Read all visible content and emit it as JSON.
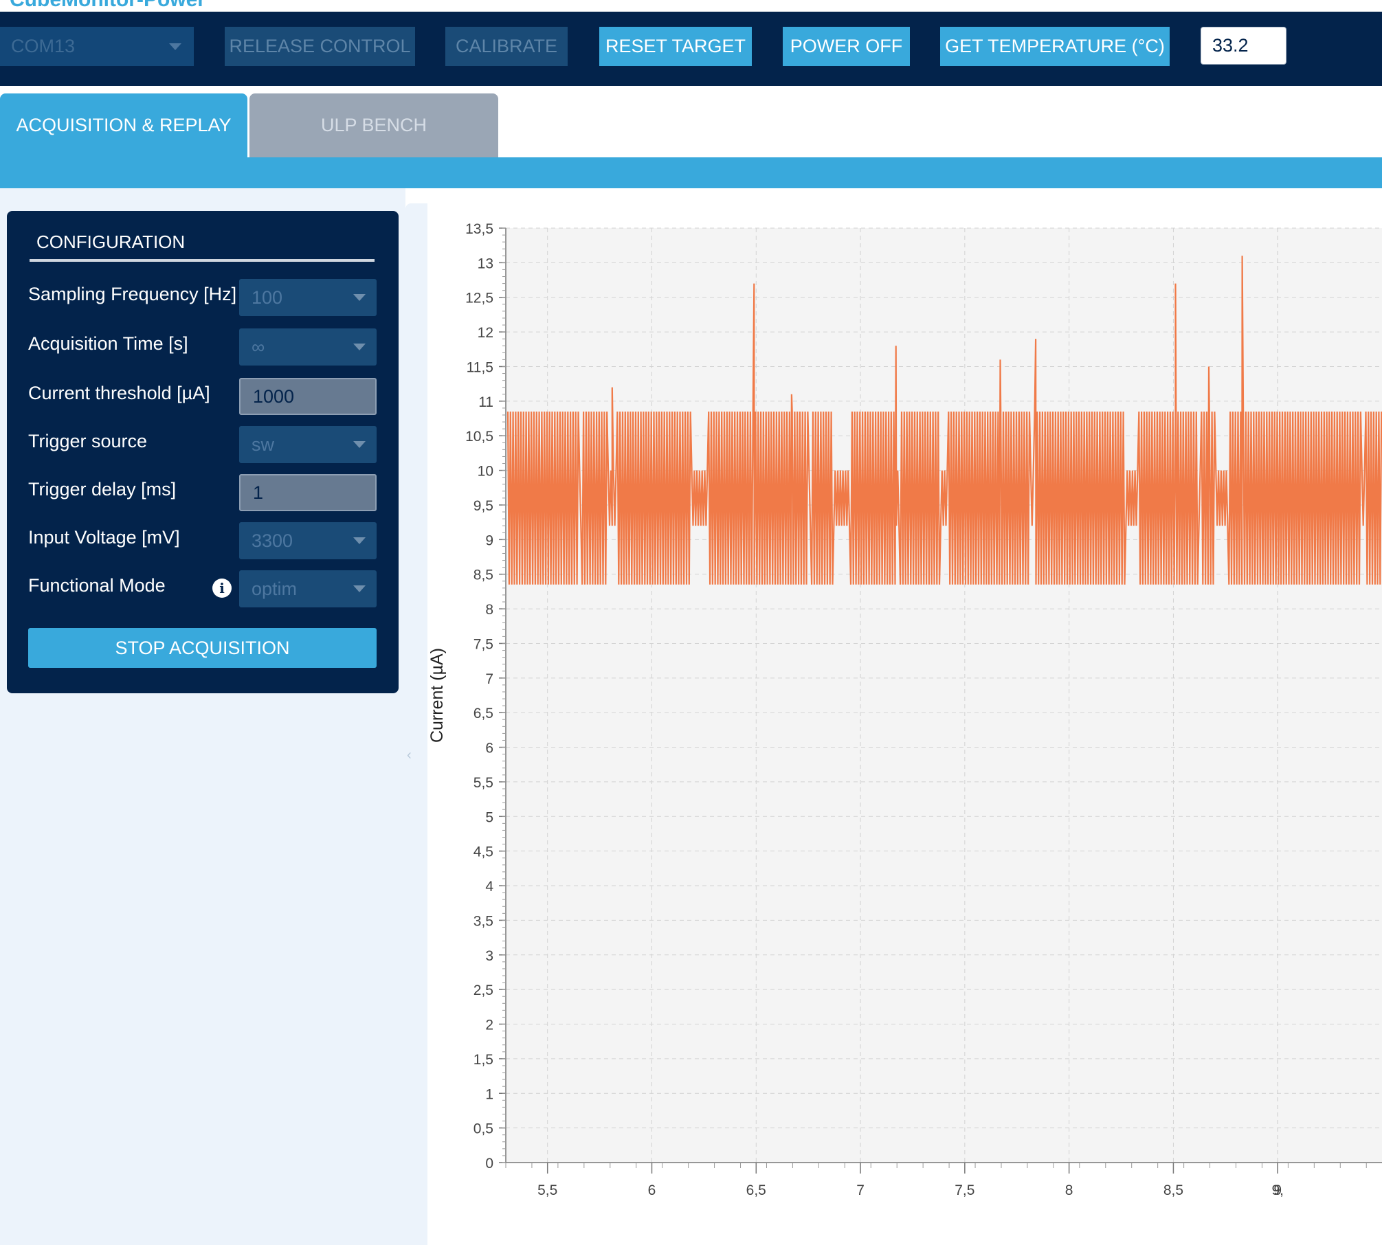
{
  "app_title": "CubeMonitor-Power",
  "toolbar": {
    "com_port": "COM13",
    "release_control": "RELEASE CONTROL",
    "calibrate": "CALIBRATE",
    "reset_target": "RESET TARGET",
    "power_off": "POWER OFF",
    "get_temperature": "GET TEMPERATURE (°C)",
    "temperature_value": "33.2"
  },
  "tabs": [
    {
      "label": "ACQUISITION & REPLAY",
      "active": true
    },
    {
      "label": "ULP BENCH",
      "active": false
    }
  ],
  "configuration": {
    "title": "CONFIGURATION",
    "rows": [
      {
        "label": "Sampling Frequency [Hz]",
        "value": "100",
        "kind": "select"
      },
      {
        "label": "Acquisition Time [s]",
        "value": "∞",
        "kind": "select"
      },
      {
        "label": "Current threshold [µA]",
        "value": "1000",
        "kind": "input"
      },
      {
        "label": "Trigger source",
        "value": "sw",
        "kind": "select"
      },
      {
        "label": "Trigger delay [ms]",
        "value": "1",
        "kind": "input"
      },
      {
        "label": "Input Voltage [mV]",
        "value": "3300",
        "kind": "select"
      },
      {
        "label": "Functional Mode",
        "value": "optim",
        "kind": "select"
      }
    ],
    "stop_button": "STOP ACQUISITION"
  },
  "colors": {
    "navy": "#03234b",
    "accent": "#39a9dc",
    "series": "#f07a48",
    "plot_bg": "#f4f4f4"
  },
  "chart_data": {
    "type": "line",
    "ylabel": "Current (µA)",
    "ylim": [
      0,
      13.5
    ],
    "xlim": [
      5.3,
      9.5
    ],
    "yticks": [
      "0",
      "0,5",
      "1",
      "1,5",
      "2",
      "2,5",
      "3",
      "3,5",
      "4",
      "4,5",
      "5",
      "5,5",
      "6",
      "6,5",
      "7",
      "7,5",
      "8",
      "8,5",
      "9",
      "9,5",
      "10",
      "10,5",
      "11",
      "11,5",
      "12",
      "12,5",
      "13",
      "13,5"
    ],
    "xticks": [
      "5,5",
      "6",
      "6,5",
      "7",
      "7,5",
      "8",
      "8,5",
      "9",
      "9,"
    ],
    "grid": true,
    "series": [
      {
        "color": "#f07a48",
        "baseline_low": 8.35,
        "baseline_high": 10.85,
        "x_start": 5.31,
        "x_end": 9.5,
        "oscillation_step": 0.0125,
        "bursts": [
          [
            5.31,
            5.65
          ],
          [
            5.66,
            5.79
          ],
          [
            5.83,
            6.19
          ],
          [
            6.27,
            6.75
          ],
          [
            6.76,
            6.87
          ],
          [
            6.95,
            7.17
          ],
          [
            7.19,
            7.38
          ],
          [
            7.42,
            7.81
          ],
          [
            7.83,
            8.27
          ],
          [
            8.33,
            8.62
          ],
          [
            8.63,
            8.7
          ],
          [
            8.76,
            9.4
          ],
          [
            9.42,
            9.5
          ]
        ],
        "spikes": [
          {
            "x": 5.81,
            "y": 11.2
          },
          {
            "x": 6.49,
            "y": 12.7
          },
          {
            "x": 6.67,
            "y": 11.1
          },
          {
            "x": 7.17,
            "y": 11.8
          },
          {
            "x": 7.67,
            "y": 11.6
          },
          {
            "x": 7.84,
            "y": 11.9
          },
          {
            "x": 8.51,
            "y": 12.7
          },
          {
            "x": 8.67,
            "y": 11.5
          },
          {
            "x": 8.83,
            "y": 13.1
          }
        ]
      }
    ]
  }
}
